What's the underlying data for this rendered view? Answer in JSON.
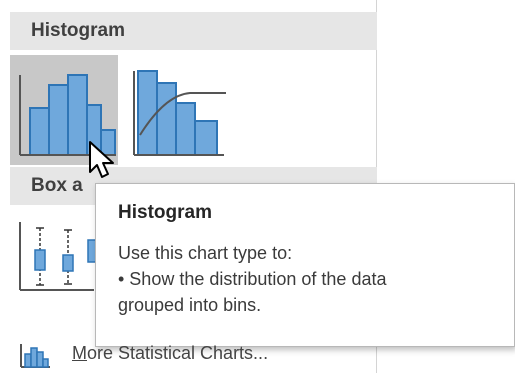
{
  "sections": {
    "histogram_header": "Histogram",
    "boxwhisker_header": "Box a"
  },
  "icons": {
    "histogram": "histogram-chart-icon",
    "pareto": "pareto-chart-icon",
    "box_whisker": "box-and-whisker-chart-icon",
    "more_stats": "statistical-chart-icon",
    "cursor": "mouse-pointer-icon"
  },
  "tooltip": {
    "title": "Histogram",
    "line1": "Use this chart type to:",
    "line2": "• Show the distribution of the data",
    "line3": "grouped into bins."
  },
  "more": {
    "accel": "M",
    "rest": "ore Statistical Charts..."
  },
  "colors": {
    "bar_fill": "#6fa8dc",
    "bar_stroke": "#2e75b6",
    "hover_bg": "#c8c8c8",
    "header_bg": "#e6e6e6"
  }
}
